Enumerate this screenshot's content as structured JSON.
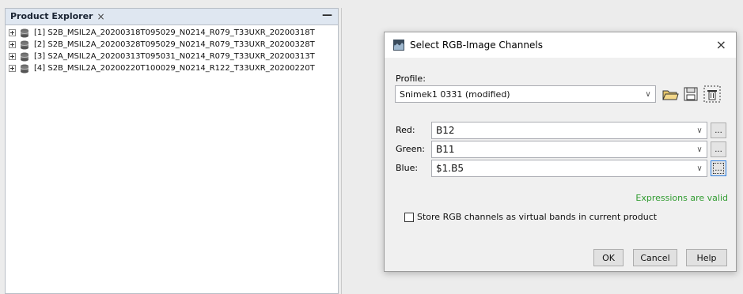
{
  "explorer": {
    "tab_title": "Product Explorer",
    "tab_close": "×",
    "minimize": "—",
    "products": [
      {
        "label": "[1] S2B_MSIL2A_20200318T095029_N0214_R079_T33UXR_20200318T"
      },
      {
        "label": "[2] S2B_MSIL2A_20200328T095029_N0214_R079_T33UXR_20200328T"
      },
      {
        "label": "[3] S2A_MSIL2A_20200313T095031_N0214_R079_T33UXR_20200313T"
      },
      {
        "label": "[4] S2B_MSIL2A_20200220T100029_N0214_R122_T33UXR_20200220T"
      }
    ]
  },
  "dialog": {
    "title": "Select RGB-Image Channels",
    "close": "×",
    "profile_label": "Profile:",
    "profile_value": "Snimek1 0331 (modified)",
    "red_label": "Red:",
    "red_value": "B12",
    "green_label": "Green:",
    "green_value": "B11",
    "blue_label": "Blue:",
    "blue_value": "$1.B5",
    "ellipsis": "...",
    "dropdown_arrow": "∨",
    "validity": "Expressions are valid",
    "store_virtual_label": "Store RGB channels as virtual bands in current product",
    "store_virtual_checked": false,
    "ok": "OK",
    "cancel": "Cancel",
    "help": "Help",
    "colors": {
      "valid": "#2f9b2f",
      "focus": "#2a7de1"
    }
  }
}
